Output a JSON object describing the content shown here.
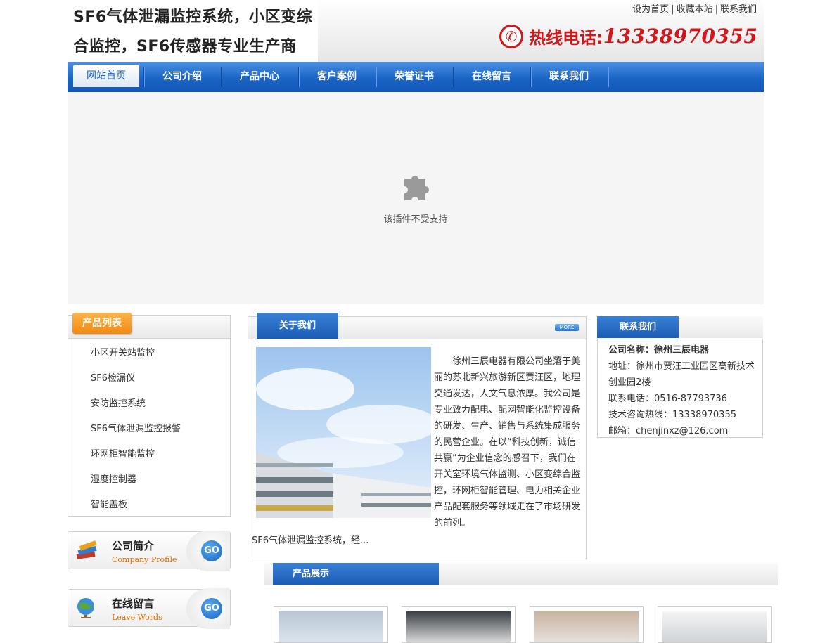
{
  "header": {
    "logo_line1": "SF6气体泄漏监控系统，小区变综",
    "logo_line2": "合监控，SF6传感器专业生产商",
    "top_links": [
      "设为首页",
      "收藏本站",
      "联系我们"
    ],
    "link_separator": "|",
    "hotline_label": "热线电话:",
    "hotline_number": "13338970355",
    "phone_icon": "phone-icon"
  },
  "nav": {
    "items": [
      "网站首页",
      "公司介绍",
      "产品中心",
      "客户案例",
      "荣誉证书",
      "在线留言",
      "联系我们"
    ],
    "active_index": 0
  },
  "banner": {
    "plugin_message": "该插件不受支持",
    "icon": "puzzle-piece-icon"
  },
  "product_list": {
    "title": "产品列表",
    "items": [
      "小区开关站监控",
      "SF6检漏仪",
      "安防监控系统",
      "SF6气体泄漏监控报警",
      "环网柜智能监控",
      "湿度控制器",
      "智能盖板"
    ]
  },
  "promos": [
    {
      "title": "公司简介",
      "subtitle": "Company Profile",
      "go": "GO",
      "icon": "books-icon"
    },
    {
      "title": "在线留言",
      "subtitle": "Leave Words",
      "go": "GO",
      "icon": "globe-icon"
    }
  ],
  "about": {
    "title": "关于我们",
    "more": "MORE",
    "text": "徐州三辰电器有限公司坐落于美丽的苏北新兴旅游新区贾汪区，地理交通发达，人文气息浓厚。我公司是专业致力配电、配网智能化监控设备的研发、生产、销售与系统集成服务的民营企业。在以“科技创新，诚信共赢”为企业信念的感召下，我们在开关室环境气体监测、小区变综合监控，环网柜智能管理、电力相关企业产品配套服务等领域走在了市场研发的前列。",
    "tail": "SF6气体泄漏监控系统，经..."
  },
  "contact": {
    "title": "联系我们",
    "company": "公司名称：徐州三辰电器",
    "address": "地址：徐州市贾汪工业园区高新技术创业园2楼",
    "phone": "联系电话：0516-87793736",
    "hotline": "技术咨询热线：13338970355",
    "email": "邮箱：chenjinxz@126.com"
  },
  "products_show": {
    "title": "产品展示"
  },
  "colors": {
    "nav_blue": "#1a64c4",
    "hotline_red": "#d0171c",
    "orange_tab": "#f08a12"
  }
}
